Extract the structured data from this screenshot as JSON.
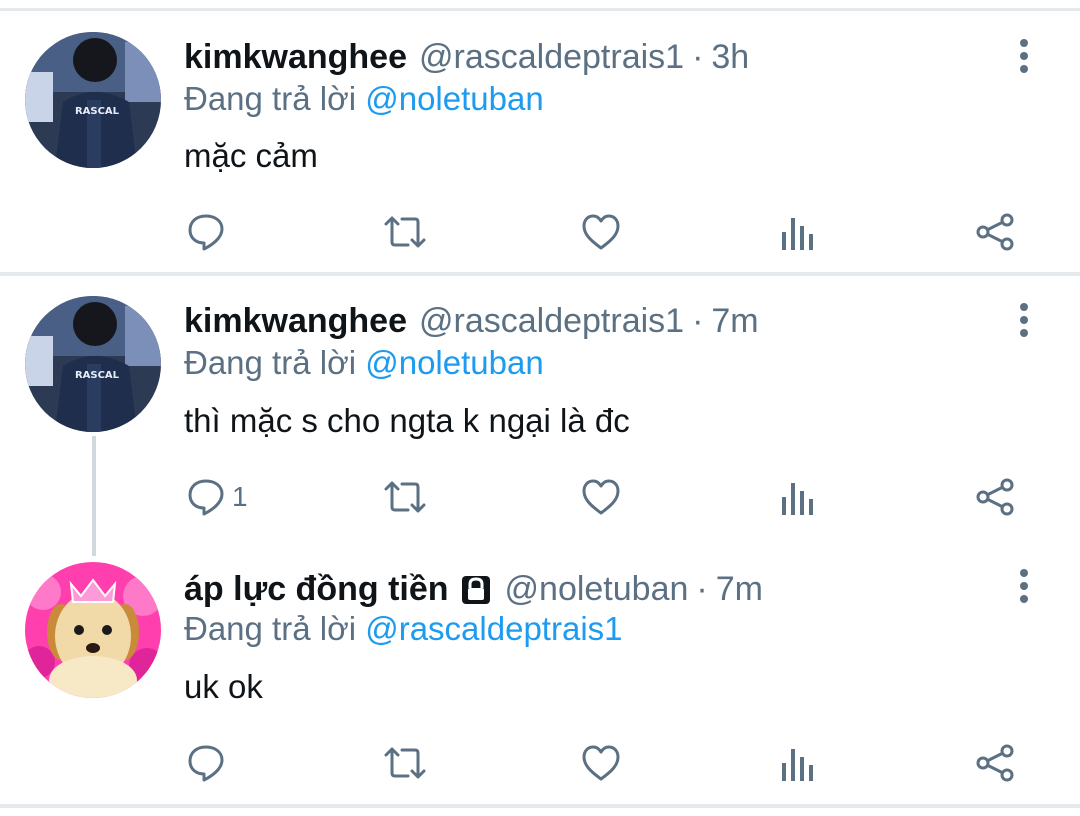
{
  "app": {
    "accent": "#1d9bf0",
    "muted": "#5b7083",
    "text": "#0f1419"
  },
  "tweets": [
    {
      "name": "kimkwanghee",
      "handle": "@rascaldeptrais1",
      "separator": "·",
      "time": "3h",
      "reply_prefix": "Đang trả lời",
      "reply_to": "@noletuban",
      "text": "mặc cảm",
      "avatar": "rascal-jacket-avatar",
      "reply_count": ""
    },
    {
      "name": "kimkwanghee",
      "handle": "@rascaldeptrais1",
      "separator": "·",
      "time": "7m",
      "reply_prefix": "Đang trả lời",
      "reply_to": "@noletuban",
      "text": "thì mặc s cho ngta k ngại là đc",
      "avatar": "rascal-jacket-avatar",
      "reply_count": "1"
    },
    {
      "name": "áp lực đồng tiền",
      "handle": "@noletuban",
      "separator": "·",
      "time": "7m",
      "reply_prefix": "Đang trả lời",
      "reply_to": "@rascaldeptrais1",
      "text": "uk ok",
      "avatar": "puppy-crown-avatar",
      "locked": true,
      "reply_count": ""
    }
  ],
  "icons": [
    "reply-icon",
    "retweet-icon",
    "like-icon",
    "analytics-icon",
    "share-icon",
    "more-icon",
    "lock-icon"
  ]
}
